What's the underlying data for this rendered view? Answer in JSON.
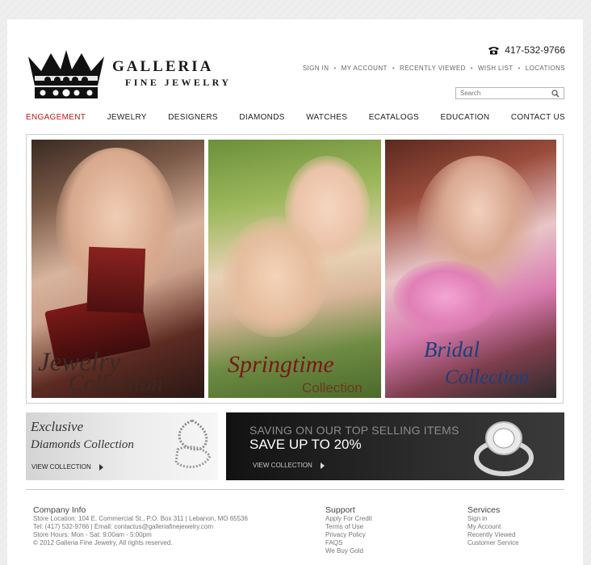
{
  "brand": {
    "name": "GALLERIA",
    "tagline": "FINE JEWELRY"
  },
  "header": {
    "phone": "417-532-9766",
    "links": [
      "SIGN IN",
      "MY ACCOUNT",
      "RECENTLY VIEWED",
      "WISH LIST",
      "LOCATIONS"
    ],
    "search_placeholder": "Search"
  },
  "nav": {
    "items": [
      "ENGAGEMENT",
      "JEWELRY",
      "DESIGNERS",
      "DIAMONDS",
      "WATCHES",
      "ECATALOGS",
      "EDUCATION",
      "CONTACT US"
    ],
    "active": "ENGAGEMENT",
    "active_color": "#c41818"
  },
  "hero": {
    "panels": [
      {
        "line1": "Jewelry",
        "line2": "Collection"
      },
      {
        "line1": "Springtime",
        "line2": "Collection"
      },
      {
        "line1": "Bridal",
        "line2": "Collection"
      }
    ]
  },
  "promos": {
    "left": {
      "line1": "Exclusive",
      "line2": "Diamonds Collection",
      "cta": "VIEW COLLECTION"
    },
    "right": {
      "line1": "SAVING ON OUR TOP SELLING ITEMS",
      "line2": "SAVE UP TO 20%",
      "cta": "VIEW COLLECTION"
    }
  },
  "footer": {
    "company": {
      "title": "Company Info",
      "lines": [
        "Store Location: 104 E. Commercial St., P.O. Box 311 | Lebanon,  MO  65536",
        "Tel: (417) 532-9766 | Email: contactus@galleriafinejewelry.com",
        "Store Hours: Mon - Sat: 9:00am - 5:00pm",
        "© 2012 Galleria Fine Jewelry, All rights reserved."
      ]
    },
    "support": {
      "title": "Support",
      "links": [
        "Apply For Credit",
        "Terms of Use",
        "Privacy Policy",
        "FAQS",
        "We Buy Gold"
      ]
    },
    "services": {
      "title": "Services",
      "links": [
        "Sign in",
        "My Account",
        "Recently Viewed",
        "Customer Service"
      ]
    }
  },
  "icons": [
    "crown-icon",
    "phone-icon",
    "search-icon",
    "play-arrow-icon"
  ]
}
